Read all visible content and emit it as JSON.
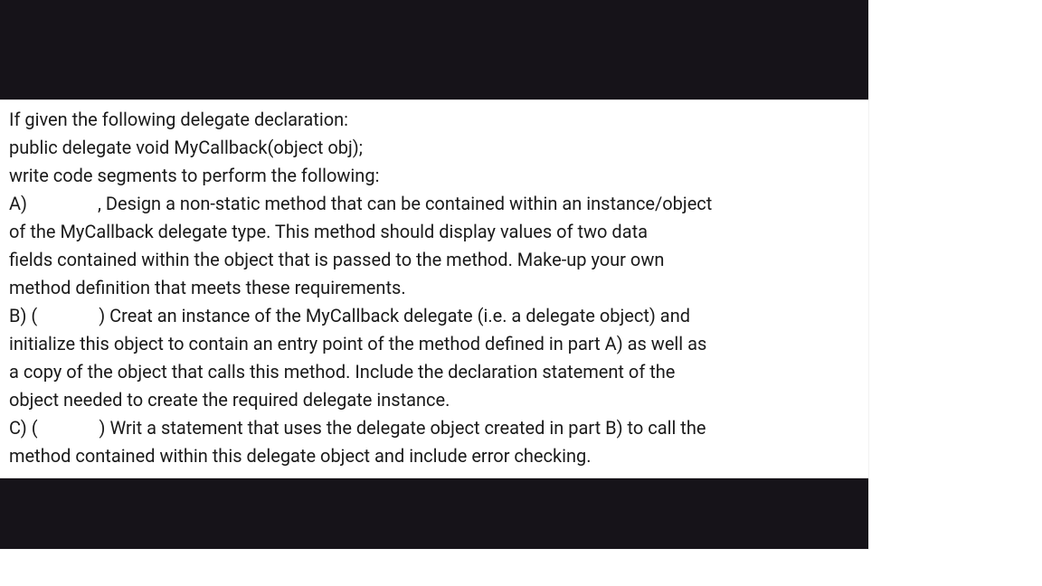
{
  "question": {
    "intro1": "If given the following delegate declaration:",
    "intro2": "public delegate void MyCallback(object obj);",
    "intro3": "write code segments to perform the following:",
    "a_label": "A)",
    "a_mid": ", Design a non-static method that can be contained within an instance/object",
    "a_l2": "of the MyCallback delegate type. This method should display values of two data",
    "a_l3": "fields contained within the object that is passed to the method. Make-up your own",
    "a_l4": "method definition that meets these requirements.",
    "b_label": "B) (",
    "b_mid": ") Creat an instance of the MyCallback delegate (i.e. a delegate object) and",
    "b_l2": "initialize this object to contain an entry point of the method defined in part A) as well as",
    "b_l3": "a copy of the object that calls this method. Include the declaration statement of the",
    "b_l4": "object needed to create the required delegate instance.",
    "c_label": "C) (",
    "c_mid": ") Writ a statement that uses the delegate object created in part B) to call the",
    "c_l2": "method contained within this delegate object and include error checking."
  }
}
